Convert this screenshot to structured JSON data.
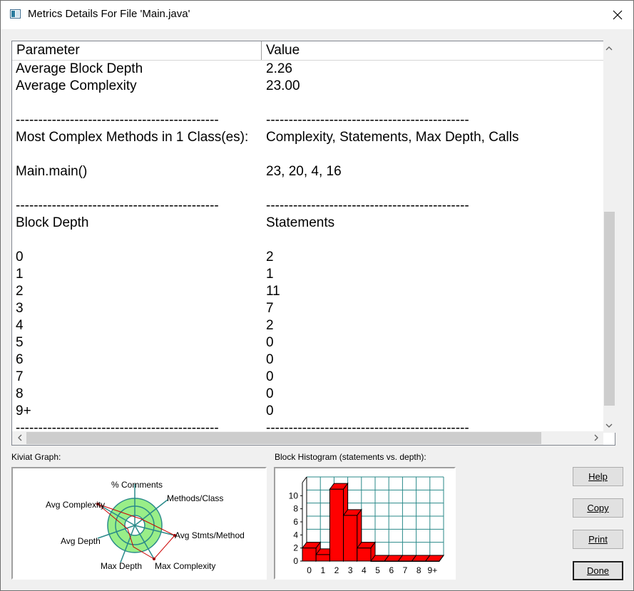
{
  "window": {
    "title": "Metrics Details For File 'Main.java'"
  },
  "table": {
    "headers": [
      "Parameter",
      "Value"
    ],
    "rows": [
      [
        "Average Block Depth",
        "2.26"
      ],
      [
        "Average Complexity",
        "23.00"
      ],
      [
        "",
        ""
      ],
      [
        "---------------------------------------------",
        "---------------------------------------------"
      ],
      [
        "Most Complex Methods in 1 Class(es):",
        "Complexity, Statements, Max Depth, Calls"
      ],
      [
        "",
        ""
      ],
      [
        "Main.main()",
        "23, 20, 4, 16"
      ],
      [
        "",
        ""
      ],
      [
        "---------------------------------------------",
        "---------------------------------------------"
      ],
      [
        "Block Depth",
        "Statements"
      ],
      [
        "",
        ""
      ],
      [
        "0",
        "2"
      ],
      [
        "1",
        "1"
      ],
      [
        "2",
        "11"
      ],
      [
        "3",
        "7"
      ],
      [
        "4",
        "2"
      ],
      [
        "5",
        "0"
      ],
      [
        "6",
        "0"
      ],
      [
        "7",
        "0"
      ],
      [
        "8",
        "0"
      ],
      [
        "9+",
        "0"
      ],
      [
        "---------------------------------------------",
        "---------------------------------------------"
      ]
    ]
  },
  "kiviat": {
    "label": "Kiviat Graph:",
    "axes": [
      "% Comments",
      "Methods/Class",
      "Avg Stmts/Method",
      "Max Complexity",
      "Max Depth",
      "Avg Depth",
      "Avg Complexity"
    ]
  },
  "histogram": {
    "label": "Block Histogram (statements vs. depth):"
  },
  "buttons": {
    "help": "Help",
    "copy": "Copy",
    "print": "Print",
    "done": "Done"
  },
  "chart_data": {
    "type": "bar",
    "categories": [
      "0",
      "1",
      "2",
      "3",
      "4",
      "5",
      "6",
      "7",
      "8",
      "9+"
    ],
    "values": [
      2,
      1,
      11,
      7,
      2,
      0,
      0,
      0,
      0,
      0
    ],
    "ylim": [
      0,
      12
    ],
    "yticks": [
      0,
      2,
      4,
      6,
      8,
      10
    ],
    "grid": true,
    "colors": {
      "bar": "#ff0000",
      "grid": "#2a8a8a"
    }
  }
}
